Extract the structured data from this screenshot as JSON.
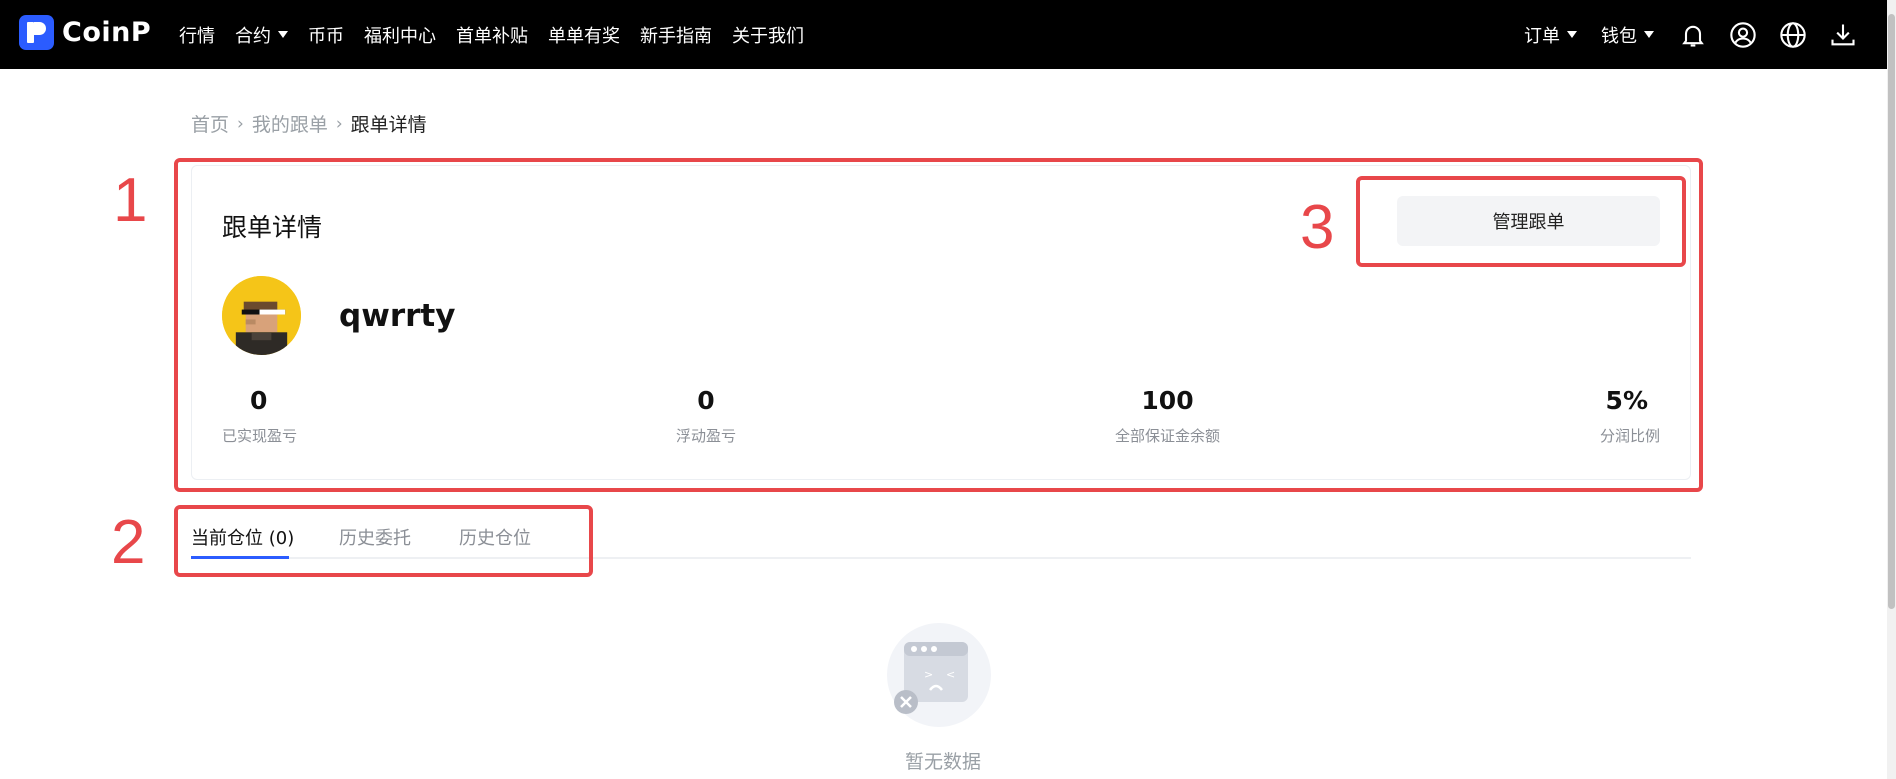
{
  "brand": {
    "name": "CoinP",
    "accent": "#2b5cff"
  },
  "nav": {
    "items": [
      "行情",
      "合约",
      "币币",
      "福利中心",
      "首单补贴",
      "单单有奖",
      "新手指南",
      "关于我们"
    ],
    "right_items": [
      "订单",
      "钱包"
    ],
    "icons": [
      "bell-icon",
      "user-icon",
      "globe-icon",
      "download-icon"
    ]
  },
  "breadcrumb": {
    "home": "首页",
    "mine": "我的跟单",
    "current": "跟单详情"
  },
  "card": {
    "title": "跟单详情",
    "manage_label": "管理跟单",
    "username": "qwrrty",
    "stats": [
      {
        "value": "0",
        "label": "已实现盈亏"
      },
      {
        "value": "0",
        "label": "浮动盈亏"
      },
      {
        "value": "100",
        "label": "全部保证金余额"
      },
      {
        "value": "5%",
        "label": "分润比例"
      }
    ]
  },
  "tabs": [
    "当前仓位 (0)",
    "历史委托",
    "历史仓位"
  ],
  "empty": {
    "text": "暂无数据"
  },
  "annotations": {
    "one": "1",
    "two": "2",
    "three": "3",
    "color": "#e8474a"
  }
}
